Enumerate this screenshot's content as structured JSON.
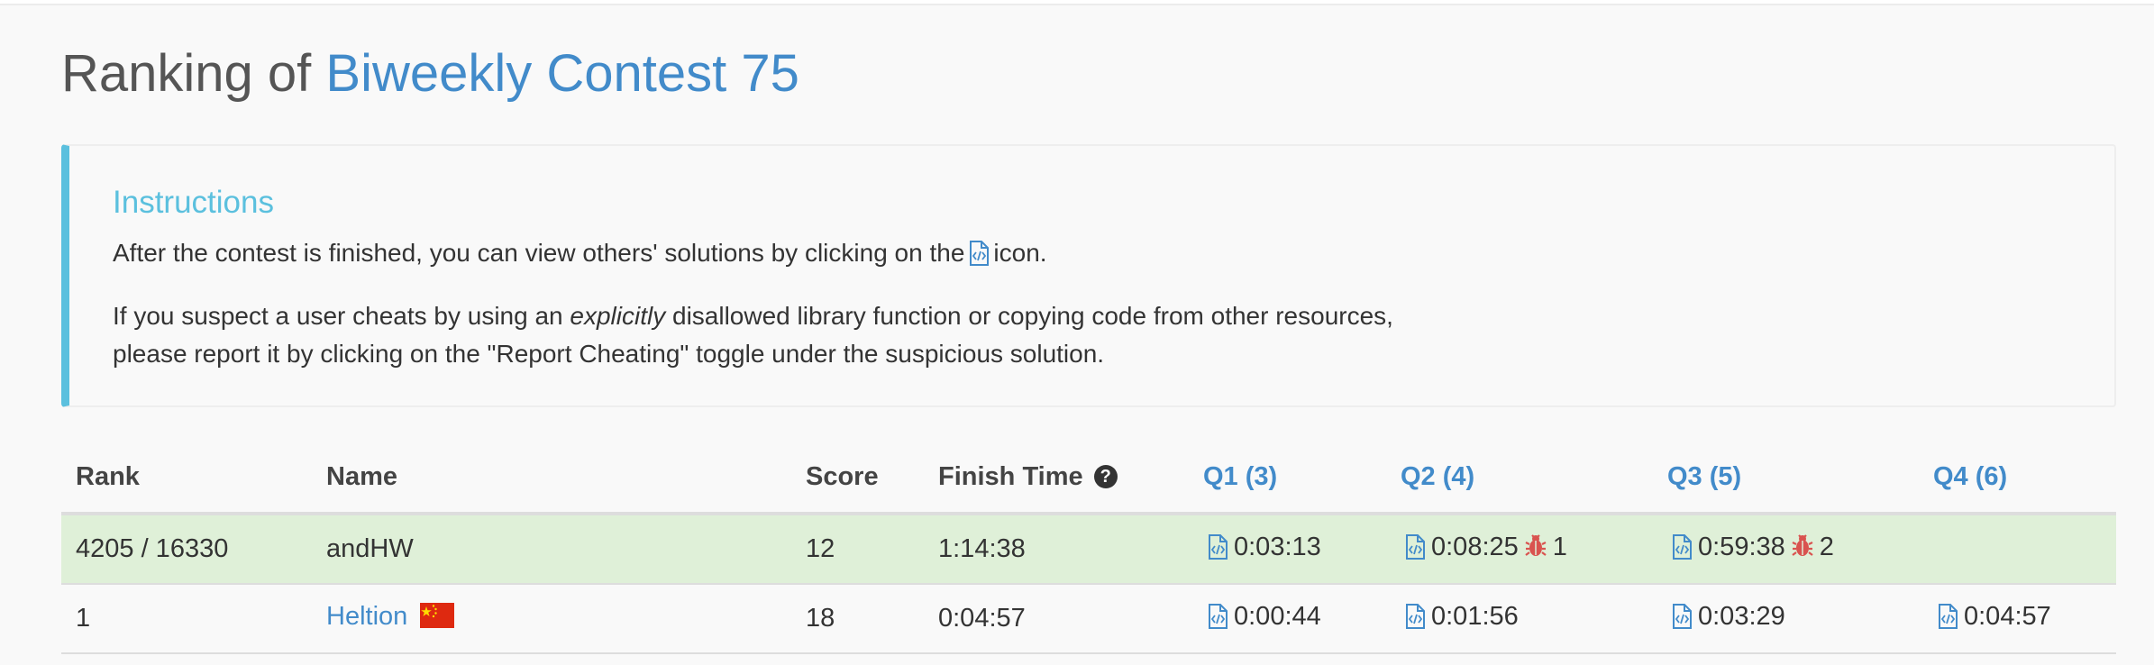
{
  "page": {
    "title_prefix": "Ranking of ",
    "contest_name": "Biweekly Contest 75"
  },
  "instructions": {
    "heading": "Instructions",
    "p1_before_icon": "After the contest is finished, you can view others' solutions by clicking on the",
    "p1_after_icon": "icon.",
    "p2_line1_before": "If you suspect a user cheats by using an ",
    "p2_line1_em": "explicitly",
    "p2_line1_after": " disallowed library function or copying code from other resources,",
    "p2_line2": "please report it by clicking on the \"Report Cheating\" toggle under the suspicious solution."
  },
  "table": {
    "headers": {
      "rank": "Rank",
      "name": "Name",
      "score": "Score",
      "finish_time": "Finish Time",
      "q1": "Q1 (3)",
      "q2": "Q2 (4)",
      "q3": "Q3 (5)",
      "q4": "Q4 (6)"
    },
    "rows": [
      {
        "rank": "4205 / 16330",
        "name": "andHW",
        "score": "12",
        "finish_time": "1:14:38",
        "q1": {
          "time": "0:03:13",
          "wrong": ""
        },
        "q2": {
          "time": "0:08:25",
          "wrong": "1"
        },
        "q3": {
          "time": "0:59:38",
          "wrong": "2"
        },
        "q4": {
          "time": "",
          "wrong": ""
        },
        "highlighted": true
      },
      {
        "rank": "1",
        "name": "Heltion",
        "country_flag": "china-flag-icon",
        "score": "18",
        "finish_time": "0:04:57",
        "q1": {
          "time": "0:00:44",
          "wrong": ""
        },
        "q2": {
          "time": "0:01:56",
          "wrong": ""
        },
        "q3": {
          "time": "0:03:29",
          "wrong": ""
        },
        "q4": {
          "time": "0:04:57",
          "wrong": ""
        },
        "highlighted": false
      }
    ]
  },
  "colors": {
    "accent": "#428bca",
    "info": "#5bc0de",
    "highlight_row": "#dff0d8",
    "bug": "#d9534f"
  },
  "icons": [
    "code-file-icon",
    "question-circle-icon",
    "bug-icon",
    "china-flag-icon"
  ]
}
